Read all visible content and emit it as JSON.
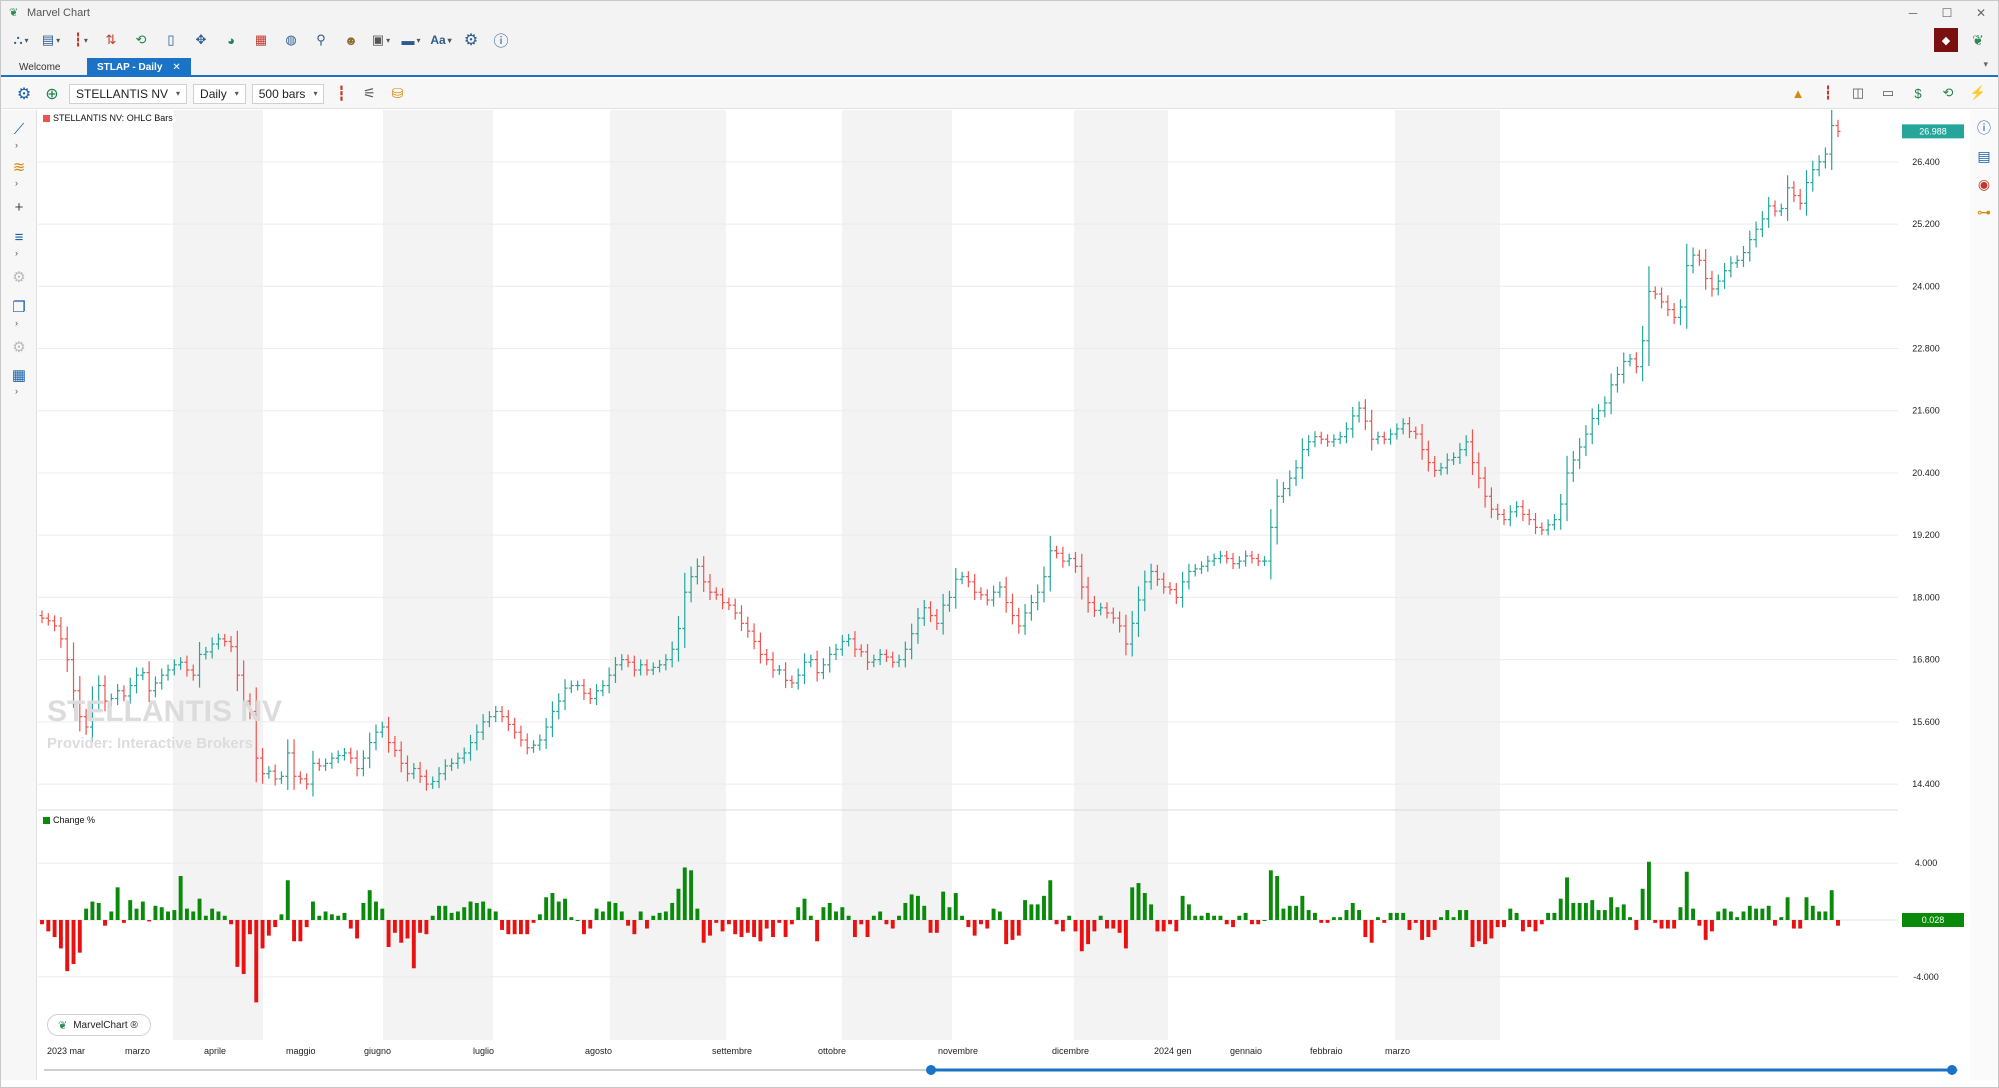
{
  "window": {
    "title": "Marvel Chart",
    "minimize": "─",
    "maximize": "☐",
    "close": "✕"
  },
  "tabs": [
    {
      "label": "Welcome"
    },
    {
      "label": "STLAP - Daily",
      "close": "✕"
    }
  ],
  "chart_toolbar": {
    "symbol": "STELLANTIS NV",
    "timeframe": "Daily",
    "bars": "500 bars"
  },
  "main_panel": {
    "label": "STELLANTIS NV: OHLC Bars",
    "price_tag": "26.988",
    "y_ticks": [
      "26.400",
      "25.200",
      "24.000",
      "22.800",
      "21.600",
      "20.400",
      "19.200",
      "18.000",
      "16.800",
      "15.600",
      "14.400"
    ],
    "watermark_name": "STELLANTIS NV",
    "watermark_provider": "Provider: Interactive Brokers",
    "colors": {
      "up": "#26a69a",
      "down": "#ef5350",
      "band": "#f3f3f3",
      "tag": "#26a69a"
    }
  },
  "sub_panel": {
    "label": "Change %",
    "value_tag": "0.028",
    "y_ticks": [
      "4.000",
      "-4.000"
    ],
    "colors": {
      "up": "#0a8a0a",
      "down": "#e81010",
      "tag": "#0a8a0a"
    }
  },
  "x_axis": {
    "labels": [
      "2023 mar",
      "marzo",
      "aprile",
      "maggio",
      "giugno",
      "luglio",
      "agosto",
      "settembre",
      "ottobre",
      "novembre",
      "dicembre",
      "2024 gen",
      "gennaio",
      "febbraio",
      "marzo"
    ]
  },
  "brand_badge": "MarvelChart ®",
  "icons": {
    "main_toolbar": [
      "network-icon",
      "layout-icon",
      "bar-type-icon",
      "compare-icon",
      "refresh-icon",
      "document-icon",
      "crosshair-icon",
      "pie-icon",
      "calendar-icon",
      "globe-icon",
      "search-user-icon",
      "user-icon",
      "window-icon",
      "line-style-icon",
      "font-icon",
      "settings-icon",
      "info-icon"
    ],
    "chart_toolbar_right": [
      "cart-icon",
      "bars-icon",
      "ticket-icon",
      "keyboard-icon",
      "dollar-icon",
      "history-icon",
      "bolt-icon"
    ]
  },
  "chart_data": {
    "type": "ohlc",
    "title": "STELLANTIS NV: OHLC Bars",
    "ylim": [
      13.9,
      27.4
    ],
    "x": [
      "2023 mar",
      "marzo",
      "aprile",
      "maggio",
      "giugno",
      "luglio",
      "agosto",
      "settembre",
      "ottobre",
      "novembre",
      "dicembre",
      "2024 gen",
      "gennaio",
      "febbraio",
      "marzo"
    ],
    "close": [
      17.6,
      17.55,
      17.45,
      17.2,
      16.8,
      16.2,
      15.7,
      15.5,
      16.0,
      16.3,
      16.0,
      16.05,
      16.2,
      16.1,
      16.3,
      16.5,
      16.55,
      16.2,
      16.35,
      16.5,
      16.6,
      16.7,
      16.75,
      16.6,
      16.5,
      16.9,
      16.95,
      17.1,
      17.2,
      17.15,
      17.05,
      16.5,
      16.0,
      15.8,
      14.9,
      14.6,
      14.65,
      14.5,
      14.55,
      15.0,
      14.55,
      14.5,
      14.4,
      14.8,
      14.75,
      14.8,
      14.9,
      14.95,
      15.0,
      14.9,
      14.7,
      14.9,
      15.2,
      15.4,
      15.5,
      15.2,
      15.05,
      14.8,
      14.6,
      14.7,
      14.55,
      14.4,
      14.45,
      14.6,
      14.75,
      14.8,
      14.9,
      15.0,
      15.2,
      15.4,
      15.6,
      15.7,
      15.8,
      15.7,
      15.55,
      15.4,
      15.25,
      15.1,
      15.15,
      15.25,
      15.5,
      15.8,
      16.0,
      16.25,
      16.3,
      16.3,
      16.15,
      16.05,
      16.2,
      16.3,
      16.5,
      16.7,
      16.8,
      16.75,
      16.6,
      16.7,
      16.6,
      16.65,
      16.7,
      16.8,
      17.0,
      17.4,
      18.1,
      18.4,
      18.6,
      18.3,
      18.1,
      18.05,
      17.9,
      17.85,
      17.7,
      17.5,
      17.35,
      17.15,
      16.9,
      16.8,
      16.6,
      16.6,
      16.4,
      16.35,
      16.5,
      16.75,
      16.8,
      16.55,
      16.7,
      16.9,
      17.0,
      17.15,
      17.2,
      17.0,
      16.95,
      16.75,
      16.8,
      16.9,
      16.85,
      16.75,
      16.8,
      17.0,
      17.3,
      17.6,
      17.8,
      17.65,
      17.5,
      17.85,
      18.0,
      18.35,
      18.4,
      18.3,
      18.1,
      18.05,
      17.95,
      18.1,
      18.2,
      17.9,
      17.65,
      17.45,
      17.7,
      17.9,
      18.1,
      18.4,
      18.9,
      18.85,
      18.7,
      18.75,
      18.6,
      18.2,
      17.9,
      17.75,
      17.8,
      17.7,
      17.6,
      17.45,
      17.1,
      17.5,
      17.95,
      18.3,
      18.5,
      18.35,
      18.2,
      18.15,
      18.0,
      18.3,
      18.5,
      18.55,
      18.6,
      18.7,
      18.75,
      18.8,
      18.75,
      18.65,
      18.7,
      18.8,
      18.75,
      18.7,
      18.7,
      19.35,
      19.95,
      20.1,
      20.3,
      20.5,
      20.85,
      21.0,
      21.1,
      21.05,
      21.0,
      21.05,
      21.1,
      21.25,
      21.5,
      21.65,
      21.4,
      21.05,
      21.1,
      21.05,
      21.15,
      21.25,
      21.35,
      21.2,
      21.15,
      20.85,
      20.6,
      20.45,
      20.5,
      20.65,
      20.7,
      20.85,
      21.0,
      20.6,
      20.3,
      19.95,
      19.7,
      19.6,
      19.5,
      19.65,
      19.75,
      19.6,
      19.5,
      19.35,
      19.3,
      19.4,
      19.5,
      19.8,
      20.4,
      20.65,
      20.9,
      21.15,
      21.45,
      21.6,
      21.75,
      22.1,
      22.3,
      22.55,
      22.6,
      22.45,
      22.95,
      23.9,
      23.85,
      23.7,
      23.55,
      23.4,
      23.6,
      24.4,
      24.6,
      24.5,
      24.15,
      23.95,
      24.1,
      24.3,
      24.45,
      24.5,
      24.65,
      24.9,
      25.1,
      25.3,
      25.55,
      25.45,
      25.5,
      25.9,
      25.75,
      25.6,
      26.0,
      26.25,
      26.4,
      26.55,
      27.1,
      26.988
    ],
    "change_pct": [
      -0.3,
      -0.8,
      -1.2,
      -2.0,
      -3.6,
      -3.1,
      -2.3,
      0.8,
      1.3,
      1.2,
      -0.4,
      0.6,
      2.3,
      -0.2,
      1.4,
      0.8,
      1.3,
      -0.1,
      1.0,
      0.9,
      0.6,
      0.7,
      3.1,
      0.8,
      0.6,
      1.5,
      0.3,
      0.8,
      0.6,
      0.3,
      -0.3,
      -3.3,
      -3.8,
      -1.0,
      -5.8,
      -2.0,
      -1.1,
      -0.5,
      0.4,
      2.8,
      -1.5,
      -1.5,
      -0.5,
      1.3,
      0.3,
      0.6,
      0.4,
      0.3,
      0.5,
      -0.6,
      -1.3,
      1.2,
      2.1,
      1.3,
      0.8,
      -1.9,
      -0.9,
      -1.6,
      -1.3,
      -3.4,
      -0.9,
      -1.0,
      0.3,
      1.0,
      1.0,
      0.5,
      0.6,
      0.9,
      1.3,
      1.2,
      1.3,
      0.8,
      0.6,
      -0.7,
      -1.0,
      -1.0,
      -1.0,
      -1.0,
      -0.2,
      0.4,
      1.6,
      1.9,
      1.3,
      1.5,
      0.2,
      0.0,
      -1.0,
      -0.6,
      0.8,
      0.6,
      1.3,
      1.2,
      0.6,
      -0.4,
      -1.0,
      0.6,
      -0.6,
      0.3,
      0.5,
      0.6,
      1.2,
      2.2,
      3.7,
      3.5,
      0.8,
      -1.6,
      -1.1,
      -0.2,
      -0.8,
      -0.3,
      -1.0,
      -1.2,
      -0.9,
      -1.2,
      -1.5,
      -0.6,
      -1.2,
      -0.2,
      -1.2,
      -0.3,
      0.9,
      1.5,
      0.3,
      -1.5,
      0.9,
      1.2,
      0.6,
      0.9,
      0.3,
      -1.2,
      -0.3,
      -1.2,
      0.3,
      0.6,
      -0.3,
      -0.6,
      0.3,
      1.2,
      1.8,
      1.7,
      1.0,
      -0.9,
      -0.9,
      2.0,
      0.9,
      1.9,
      0.3,
      -0.5,
      -1.1,
      -0.3,
      -0.6,
      0.8,
      0.6,
      -1.7,
      -1.4,
      -1.1,
      1.4,
      1.1,
      1.1,
      1.7,
      2.8,
      -0.3,
      -0.8,
      0.3,
      -0.8,
      -2.2,
      -1.7,
      -0.8,
      0.3,
      -0.6,
      -0.6,
      -0.9,
      -2.0,
      2.3,
      2.6,
      1.9,
      1.1,
      -0.8,
      -0.8,
      -0.3,
      -0.8,
      1.7,
      1.1,
      0.3,
      0.3,
      0.5,
      0.3,
      0.3,
      -0.3,
      -0.5,
      0.3,
      0.5,
      -0.3,
      -0.3,
      0.0,
      3.5,
      3.1,
      0.8,
      1.0,
      1.0,
      1.7,
      0.7,
      0.5,
      -0.2,
      -0.2,
      0.2,
      0.2,
      0.7,
      1.2,
      0.7,
      -1.2,
      -1.6,
      0.2,
      -0.2,
      0.5,
      0.5,
      0.5,
      -0.7,
      -0.2,
      -1.4,
      -1.2,
      -0.7,
      0.2,
      0.7,
      0.2,
      0.7,
      0.7,
      -1.9,
      -1.5,
      -1.7,
      -1.3,
      -0.5,
      -0.5,
      0.8,
      0.5,
      -0.8,
      -0.5,
      -0.8,
      -0.3,
      0.5,
      0.5,
      1.5,
      3.0,
      1.2,
      1.2,
      1.2,
      1.4,
      0.7,
      0.7,
      1.6,
      0.9,
      1.1,
      0.2,
      -0.7,
      2.2,
      4.1,
      -0.2,
      -0.6,
      -0.6,
      -0.6,
      0.9,
      3.4,
      0.8,
      -0.4,
      -1.4,
      -0.8,
      0.6,
      0.8,
      0.6,
      0.2,
      0.6,
      1.0,
      0.8,
      0.8,
      1.0,
      -0.4,
      0.2,
      1.6,
      -0.6,
      -0.6,
      1.6,
      1.0,
      0.6,
      0.6,
      2.1,
      -0.4
    ]
  }
}
